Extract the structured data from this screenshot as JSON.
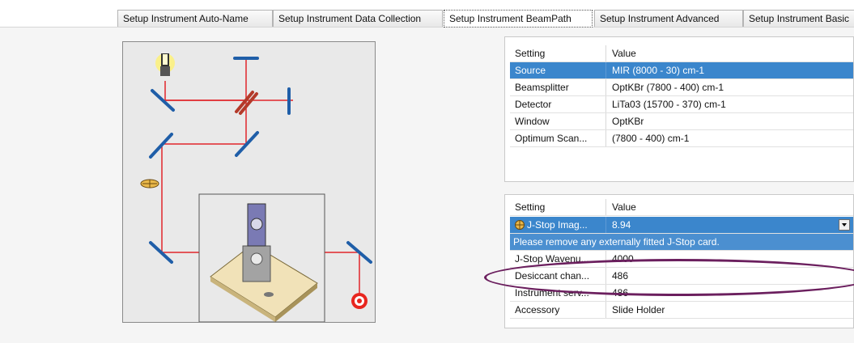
{
  "tabs": [
    {
      "label": "Setup Instrument Auto-Name"
    },
    {
      "label": "Setup Instrument Data Collection"
    },
    {
      "label": "Setup Instrument BeamPath"
    },
    {
      "label": "Setup Instrument Advanced"
    },
    {
      "label": "Setup Instrument Basic"
    }
  ],
  "active_tab_index": 2,
  "beampath_grid": {
    "header": {
      "setting": "Setting",
      "value": "Value"
    },
    "rows": [
      {
        "setting": "Source",
        "value": "MIR (8000 - 30) cm-1"
      },
      {
        "setting": "Beamsplitter",
        "value": "OptKBr (7800 - 400) cm-1"
      },
      {
        "setting": "Detector",
        "value": "LiTa03 (15700 - 370) cm-1"
      },
      {
        "setting": "Window",
        "value": "OptKBr"
      },
      {
        "setting": "Optimum Scan...",
        "value": "(7800 - 400) cm-1"
      }
    ],
    "selected_row_index": 0
  },
  "advanced_grid": {
    "header": {
      "setting": "Setting",
      "value": "Value"
    },
    "rows": [
      {
        "setting": "J-Stop Imag...",
        "value": "8.94",
        "icon": "aperture-wheel-icon",
        "dropdown": true
      },
      {
        "message": "Please remove any externally fitted J-Stop card."
      },
      {
        "setting": "J-Stop Wavenu...",
        "value": "4000"
      },
      {
        "setting": "Desiccant chan...",
        "value": "486"
      },
      {
        "setting": "Instrument serv...",
        "value": "486"
      },
      {
        "setting": "Accessory",
        "value": "Slide Holder"
      }
    ]
  },
  "annotation": {
    "highlight_color": "#6b1f5e"
  }
}
